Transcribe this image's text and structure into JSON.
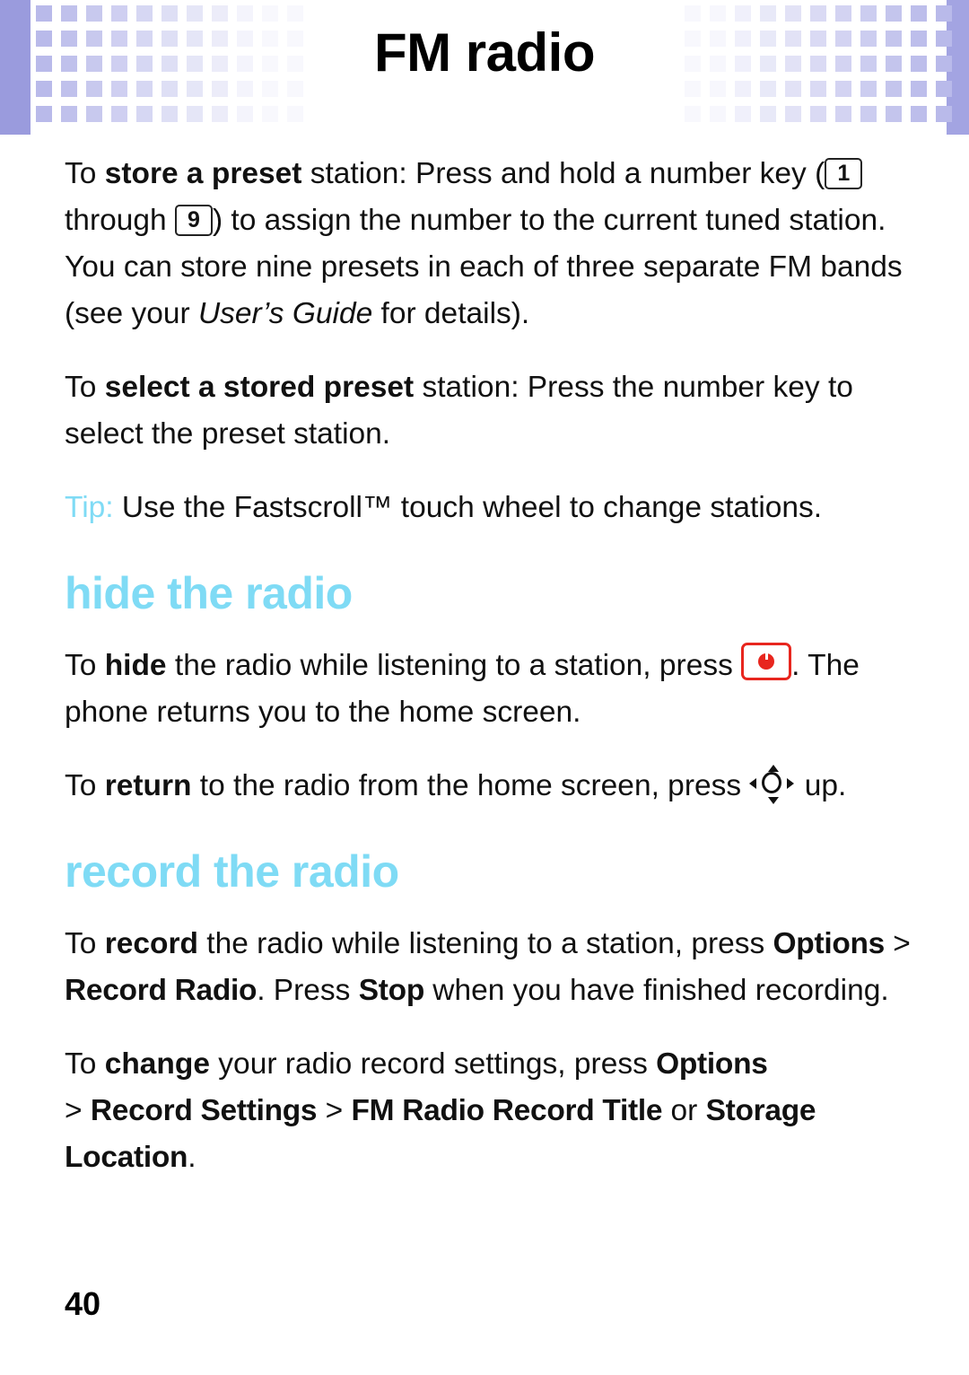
{
  "header": {
    "title": "FM radio",
    "band_color_solid": "#9a9bdd",
    "band_color_dots": "#b9baea"
  },
  "body": {
    "p1": {
      "lead_plain": "To ",
      "lead_bold": "store a preset",
      "after_bold": " station: Press and hold a number key (",
      "key1": "1",
      "mid": " through ",
      "key9": "9",
      "after_keys": ") to assign the number to the current tuned station. You can store nine presets in each of three separate FM bands (see your ",
      "italic": "User’s Guide",
      "tail": " for details)."
    },
    "p2": {
      "lead_plain": "To ",
      "lead_bold": "select a stored preset",
      "tail": " station: Press the number key to select the preset station."
    },
    "tip": {
      "label": "Tip:",
      "text": " Use the Fastscroll™ touch wheel to change stations."
    },
    "section_hide": "hide the radio",
    "p3": {
      "lead_plain": "To ",
      "lead_bold": "hide",
      "mid": " the radio while listening to a station, press ",
      "icon": "end-key-icon",
      "tail": ". The phone returns you to the home screen."
    },
    "p4": {
      "lead_plain": "To ",
      "lead_bold": "return",
      "mid": " to the radio from the home screen, press ",
      "icon": "navigation-key-icon",
      "tail": " up."
    },
    "section_record": "record the radio",
    "p5": {
      "lead_plain": "To ",
      "lead_bold": "record",
      "mid": " the radio while listening to a station, press ",
      "ui1": "Options",
      "sep1": " > ",
      "ui2": "Record Radio",
      "mid2": ". Press ",
      "ui3": "Stop",
      "tail": " when you have finished recording."
    },
    "p6": {
      "lead_plain": "To ",
      "lead_bold": "change",
      "mid": " your radio record settings, press ",
      "ui1": "Options",
      "sep1": "> ",
      "ui2": "Record Settings",
      "sep2": " > ",
      "ui3": "FM Radio Record Title",
      "mid2": " or ",
      "ui4": "Storage Location",
      "tail": "."
    }
  },
  "footer": {
    "page_number": "40"
  }
}
